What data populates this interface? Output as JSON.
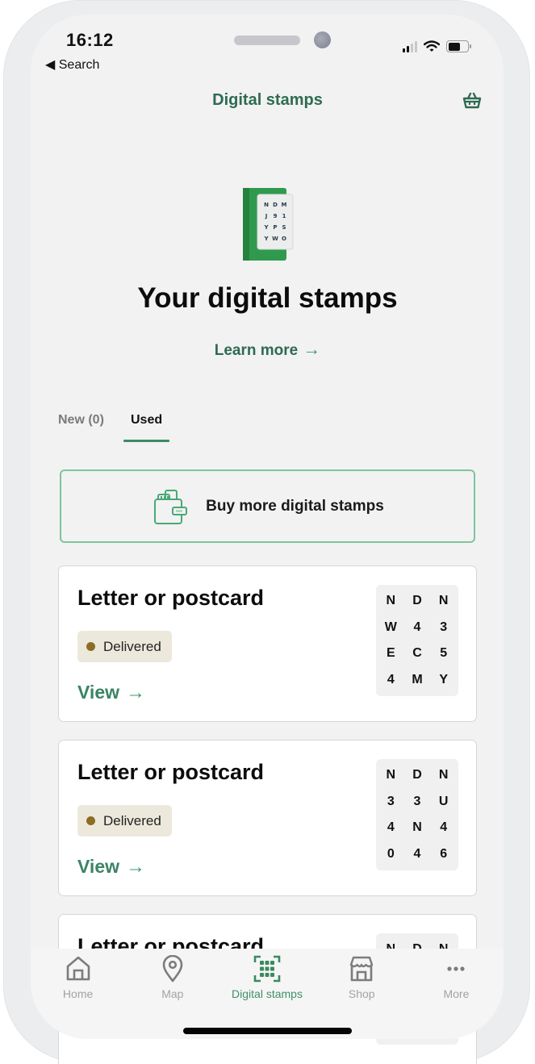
{
  "status_bar": {
    "time": "16:12",
    "back_label": "◀ Search",
    "signal_icon": "cellular-signal-icon",
    "wifi_icon": "wifi-icon",
    "battery_icon": "battery-icon"
  },
  "nav": {
    "title": "Digital stamps",
    "basket_icon": "shopping-basket-icon"
  },
  "hero": {
    "image": "digital-stamp-illustration",
    "title": "Your digital stamps",
    "learn_more_label": "Learn more",
    "arrow": "→"
  },
  "tabs": [
    {
      "label": "New (0)",
      "active": false
    },
    {
      "label": "Used",
      "active": true
    }
  ],
  "buy_button": {
    "label": "Buy more digital stamps",
    "icon": "wallet-stamps-icon"
  },
  "stamps": [
    {
      "title": "Letter or postcard",
      "status": "Delivered",
      "view_label": "View",
      "arrow": "→",
      "code": [
        "N",
        "D",
        "N",
        "W",
        "4",
        "3",
        "E",
        "C",
        "5",
        "4",
        "M",
        "Y"
      ]
    },
    {
      "title": "Letter or postcard",
      "status": "Delivered",
      "view_label": "View",
      "arrow": "→",
      "code": [
        "N",
        "D",
        "N",
        "3",
        "3",
        "U",
        "4",
        "N",
        "4",
        "0",
        "4",
        "6"
      ]
    },
    {
      "title": "Letter or postcard",
      "code_partial": [
        "N",
        "D",
        "N"
      ]
    }
  ],
  "tabbar": [
    {
      "label": "Home",
      "icon": "home-icon",
      "active": false
    },
    {
      "label": "Map",
      "icon": "map-pin-icon",
      "active": false
    },
    {
      "label": "Digital stamps",
      "icon": "digital-stamps-icon",
      "active": true
    },
    {
      "label": "Shop",
      "icon": "shop-icon",
      "active": false
    },
    {
      "label": "More",
      "icon": "more-icon",
      "active": false
    }
  ],
  "colors": {
    "brand_green": "#2e6b52",
    "accent_green": "#3a9a6a",
    "status_delivered_dot": "#8c6d23",
    "status_delivered_bg": "#ece9dc"
  }
}
